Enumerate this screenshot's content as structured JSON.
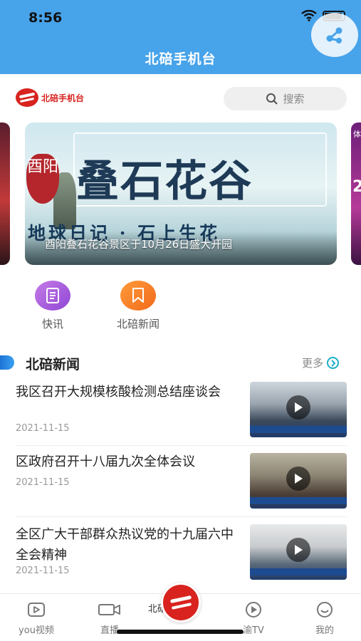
{
  "status_bar": {
    "time": "8:56"
  },
  "header": {
    "title": "北碚手机台"
  },
  "logo": {
    "text": "北碚手机台"
  },
  "search": {
    "placeholder": "搜索"
  },
  "banner": {
    "headline": "叠石花谷",
    "stamp": "酉阳",
    "subtitle": "地球日记 · 石上生花",
    "caption": "酉阳叠石花谷景区于10月26日盛大开园",
    "side_right_label": "体",
    "side_right_number": "2"
  },
  "quick_entries": [
    {
      "label": "快讯",
      "icon": "document-icon"
    },
    {
      "label": "北碚新闻",
      "icon": "bookmark-icon"
    }
  ],
  "section": {
    "title": "北碚新闻",
    "more_label": "更多"
  },
  "news": [
    {
      "title": "我区召开大规模核酸检测总结座谈会",
      "date": "2021-11-15"
    },
    {
      "title": "区政府召开十八届九次全体会议",
      "date": "2021-11-15"
    },
    {
      "title": "全区广大干部群众热议党的十九届六中全会精神",
      "date": "2021-11-15"
    }
  ],
  "tabbar": {
    "tabs": [
      {
        "label": "you视频",
        "icon": "video-icon"
      },
      {
        "label": "直播",
        "icon": "camera-icon"
      },
      {
        "label": "北碚新闻",
        "icon": "logo-icon"
      },
      {
        "label": "渝TV",
        "icon": "tv-play-icon"
      },
      {
        "label": "我的",
        "icon": "smile-icon"
      }
    ]
  },
  "colors": {
    "header": "#47a3ea",
    "brand_red": "#d8231f",
    "accent_teal": "#1ab0c8"
  }
}
